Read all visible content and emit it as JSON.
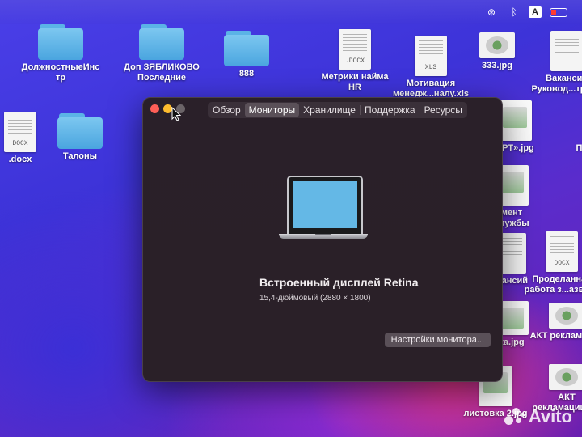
{
  "menubar": {
    "icons": [
      "creative-cloud-icon",
      "bluetooth-icon",
      "keyboard-layout-icon",
      "battery-icon"
    ],
    "input_source": "A"
  },
  "desktop": {
    "items": [
      {
        "label": "ДолжностныеИнс\nтр",
        "icon": "folder-icon"
      },
      {
        "label": "Доп ЗЯБЛИКОВО\nПоследние",
        "icon": "folder-icon"
      },
      {
        "label": "888",
        "icon": "folder-icon"
      },
      {
        "label": "Метрики найма\nHR",
        "icon": "docx-icon",
        "ext": ".DOCX"
      },
      {
        "label": "Мотивация\nменедж...налу.xls",
        "icon": "xls-icon",
        "ext": "XLS"
      },
      {
        "label": "333.jpg",
        "icon": "jpg-icon"
      },
      {
        "label": "Вакансия\nРуковод...труме",
        "icon": "document-icon"
      },
      {
        "label": ".docx",
        "icon": "docx-icon",
        "ext": "DOCX"
      },
      {
        "label": "Талоны",
        "icon": "folder-icon"
      },
      {
        "label": "АРТ».jpg",
        "icon": "jpg-icon"
      },
      {
        "label": "Пла",
        "icon": "document-icon"
      },
      {
        "label": "мент\nслужбы",
        "icon": "jpg-icon"
      },
      {
        "label": "акансий",
        "icon": "document-icon"
      },
      {
        "label": "Проделанная\nработа з...азвити",
        "icon": "docx-icon",
        "ext": "DOCX"
      },
      {
        "label": "ка.jpg",
        "icon": "jpg-icon"
      },
      {
        "label": "АКТ рекламации",
        "icon": "jpg-icon"
      },
      {
        "label": "листовка 2.jpg",
        "icon": "jpg-icon"
      },
      {
        "label": "АКТ\nрекламации.jpg",
        "icon": "jpg-icon"
      }
    ]
  },
  "window": {
    "tabs": [
      {
        "label": "Обзор",
        "active": false
      },
      {
        "label": "Мониторы",
        "active": true
      },
      {
        "label": "Хранилище",
        "active": false
      },
      {
        "label": "Поддержка",
        "active": false
      },
      {
        "label": "Ресурсы",
        "active": false
      }
    ],
    "display_name": "Встроенный дисплей Retina",
    "display_spec": "15,4-дюймовый (2880 × 1800)",
    "settings_button": "Настройки монитора..."
  },
  "watermark": {
    "text": "Avito"
  }
}
